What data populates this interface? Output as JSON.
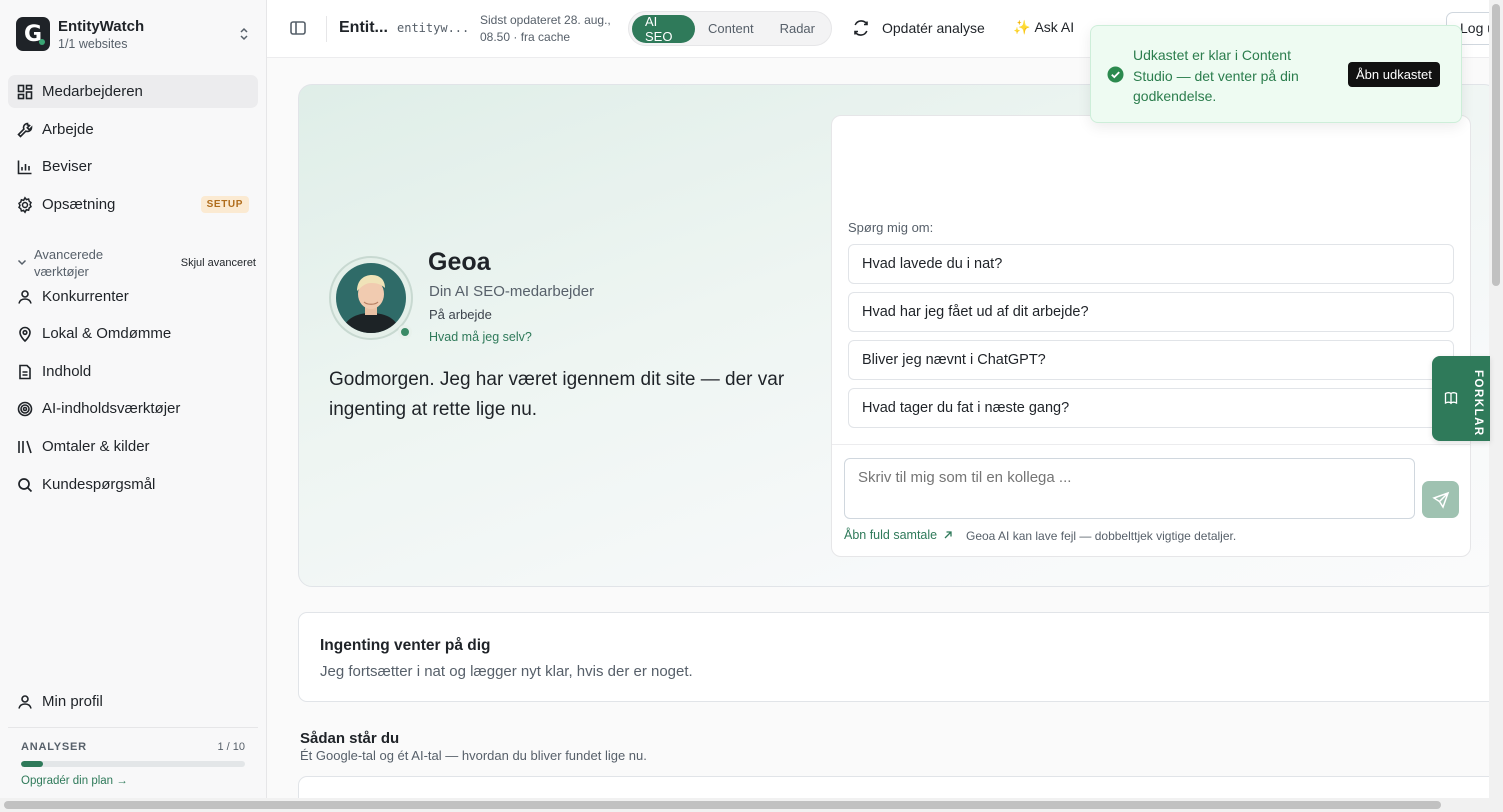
{
  "sidebar": {
    "brand": {
      "name": "EntityWatch",
      "sub": "1/1 websites"
    },
    "items": [
      {
        "label": "Medarbejderen",
        "icon": "dashboard-icon",
        "active": true
      },
      {
        "label": "Arbejde",
        "icon": "wrench-icon"
      },
      {
        "label": "Beviser",
        "icon": "bar-chart-icon"
      },
      {
        "label": "Opsætning",
        "icon": "gear-icon",
        "badge": "SETUP"
      }
    ],
    "advanced": {
      "label": "Avancerede værktøjer",
      "hide": "Skjul avanceret"
    },
    "adv_items": [
      {
        "label": "Konkurrenter",
        "icon": "user-icon"
      },
      {
        "label": "Lokal & Omdømme",
        "icon": "map-pin-icon"
      },
      {
        "label": "Indhold",
        "icon": "document-icon"
      },
      {
        "label": "AI-indholdsværktøjer",
        "icon": "target-icon"
      },
      {
        "label": "Omtaler & kilder",
        "icon": "columns-icon"
      },
      {
        "label": "Kundespørgsmål",
        "icon": "search-icon"
      }
    ],
    "profile": "Min profil",
    "analyser": {
      "title": "ANALYSER",
      "count": "1 / 10",
      "progress": 0.1,
      "upgrade": "Opgradér din plan →"
    }
  },
  "topbar": {
    "title": "Entit...",
    "domain": "entityw...",
    "updated": "Sidst opdateret 28. aug., 08.50 · fra cache",
    "segments": [
      "AI SEO",
      "Content",
      "Radar"
    ],
    "active_segment": "AI SEO",
    "refresh": "Opdatér analyse",
    "ask": "Ask AI",
    "logout": "Log ud"
  },
  "toast": {
    "message": "Udkastet er klar i Content Studio — det venter på din godkendelse.",
    "action": "Åbn udkastet"
  },
  "hero": {
    "name": "Geoa",
    "role": "Din AI SEO-medarbejder",
    "status": "På arbejde",
    "link": "Hvad må jeg selv?",
    "greeting": "Godmorgen. Jeg har været igennem dit site — der var ingenting at rette lige nu."
  },
  "chat": {
    "ask_label": "Spørg mig om:",
    "questions": [
      "Hvad lavede du i nat?",
      "Hvad har jeg fået ud af dit arbejde?",
      "Bliver jeg nævnt i ChatGPT?",
      "Hvad tager du fat i næste gang?"
    ],
    "placeholder": "Skriv til mig som til en kollega ...",
    "open_full": "Åbn fuld samtale",
    "disclaimer": "Geoa AI kan lave fejl — dobbelttjek vigtige detaljer."
  },
  "forklar": "FORKLAR",
  "pending": {
    "title": "Ingenting venter på dig",
    "sub": "Jeg fortsætter i nat og lægger nyt klar, hvis der er noget."
  },
  "standing": {
    "title": "Sådan står du",
    "sub": "Ét Google-tal og ét AI-tal — hvordan du bliver fundet lige nu."
  },
  "colors": {
    "accent": "#2f7a5a",
    "toast_bg": "#eefbf2",
    "setup_badge": "#b06d1c"
  }
}
